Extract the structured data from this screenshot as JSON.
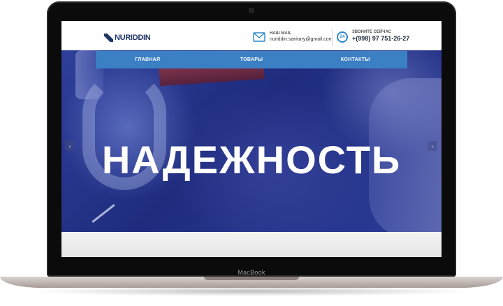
{
  "device": {
    "label": "MacBook"
  },
  "header": {
    "logo_text": "NURIDDIN",
    "mail": {
      "label": "НАШ MAIL",
      "value": "nuriddin.sanitary@gmail.com"
    },
    "phone": {
      "badge": "24",
      "label": "ЗВОНИТЕ СЕЙЧАС",
      "value": "+(998) 97 751-26-27"
    }
  },
  "nav": {
    "items": [
      {
        "label": "ГЛАВНАЯ"
      },
      {
        "label": "ТОВАРЫ"
      },
      {
        "label": "КОНТАКТЫ"
      }
    ]
  },
  "hero": {
    "title": "НАДЕЖНОСТЬ",
    "prev_arrow": "‹",
    "next_arrow": "›"
  },
  "colors": {
    "brand": "#1f3566",
    "nav_bg": "#3b7fc4",
    "hero_bg": "#26358d",
    "accent": "#2b88c8"
  }
}
